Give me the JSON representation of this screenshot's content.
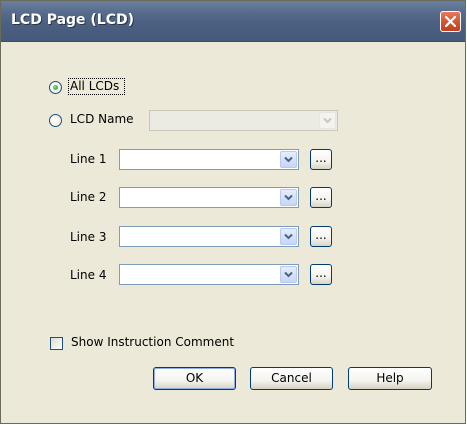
{
  "window": {
    "title": "LCD Page (LCD)"
  },
  "target": {
    "all_lcds_label": "All LCDs",
    "all_lcds_selected": true,
    "lcd_name_label": "LCD Name",
    "lcd_name_selected": false,
    "lcd_name_value": ""
  },
  "lines": [
    {
      "label": "Line 1",
      "value": "",
      "browse_label": "..."
    },
    {
      "label": "Line 2",
      "value": "",
      "browse_label": "..."
    },
    {
      "label": "Line 3",
      "value": "",
      "browse_label": "..."
    },
    {
      "label": "Line 4",
      "value": "",
      "browse_label": "..."
    }
  ],
  "options": {
    "show_instruction_comment_label": "Show Instruction Comment",
    "show_instruction_comment_checked": false
  },
  "buttons": {
    "ok": "OK",
    "cancel": "Cancel",
    "help": "Help"
  },
  "colors": {
    "titlebar": "#4b6081",
    "dialog_bg": "#ece9d8",
    "close_button": "#d65530",
    "radio_selected": "#21a121"
  }
}
